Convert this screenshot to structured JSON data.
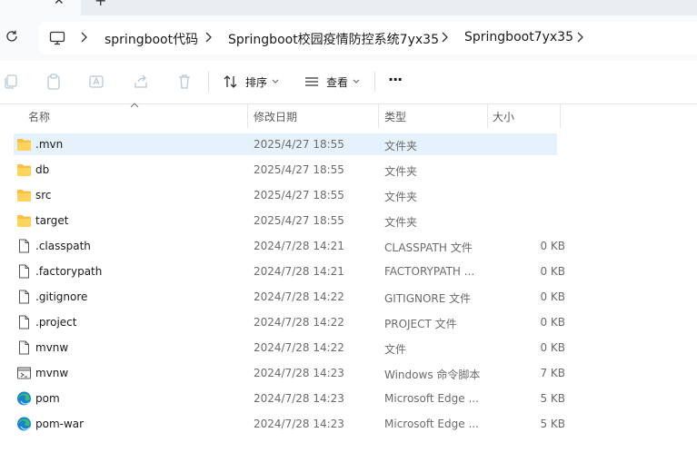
{
  "tabbar": {
    "close_glyph": "✕",
    "new_glyph": "+"
  },
  "breadcrumbs": [
    "springboot代码",
    "Springboot校园疫情防控系统7yx35",
    "Springboot7yx35"
  ],
  "toolbar": {
    "sort_label": "排序",
    "view_label": "查看",
    "more_label": "···"
  },
  "columns": {
    "name": "名称",
    "date": "修改日期",
    "type": "类型",
    "size": "大小"
  },
  "files": [
    {
      "name": ".mvn",
      "date": "2025/4/27 18:55",
      "type": "文件夹",
      "size": "",
      "icon": "folder-icon",
      "selected": true
    },
    {
      "name": "db",
      "date": "2025/4/27 18:55",
      "type": "文件夹",
      "size": "",
      "icon": "folder-icon"
    },
    {
      "name": "src",
      "date": "2025/4/27 18:55",
      "type": "文件夹",
      "size": "",
      "icon": "folder-icon"
    },
    {
      "name": "target",
      "date": "2025/4/27 18:55",
      "type": "文件夹",
      "size": "",
      "icon": "folder-icon"
    },
    {
      "name": ".classpath",
      "date": "2024/7/28 14:21",
      "type": "CLASSPATH 文件",
      "size": "0 KB",
      "icon": "file-icon"
    },
    {
      "name": ".factorypath",
      "date": "2024/7/28 14:21",
      "type": "FACTORYPATH ...",
      "size": "0 KB",
      "icon": "file-icon"
    },
    {
      "name": ".gitignore",
      "date": "2024/7/28 14:22",
      "type": "GITIGNORE 文件",
      "size": "0 KB",
      "icon": "file-icon"
    },
    {
      "name": ".project",
      "date": "2024/7/28 14:22",
      "type": "PROJECT 文件",
      "size": "0 KB",
      "icon": "file-icon"
    },
    {
      "name": "mvnw",
      "date": "2024/7/28 14:22",
      "type": "文件",
      "size": "0 KB",
      "icon": "file-icon"
    },
    {
      "name": "mvnw",
      "date": "2024/7/28 14:23",
      "type": "Windows 命令脚本",
      "size": "7 KB",
      "icon": "script-icon"
    },
    {
      "name": "pom",
      "date": "2024/7/28 14:23",
      "type": "Microsoft Edge ...",
      "size": "5 KB",
      "icon": "edge-icon"
    },
    {
      "name": "pom-war",
      "date": "2024/7/28 14:23",
      "type": "Microsoft Edge ...",
      "size": "5 KB",
      "icon": "edge-icon"
    }
  ],
  "colors": {
    "folder": "#f8c03e",
    "selection": "#e5f1fb",
    "edge_blue": "#1c7fd6",
    "edge_green": "#36c06a"
  }
}
